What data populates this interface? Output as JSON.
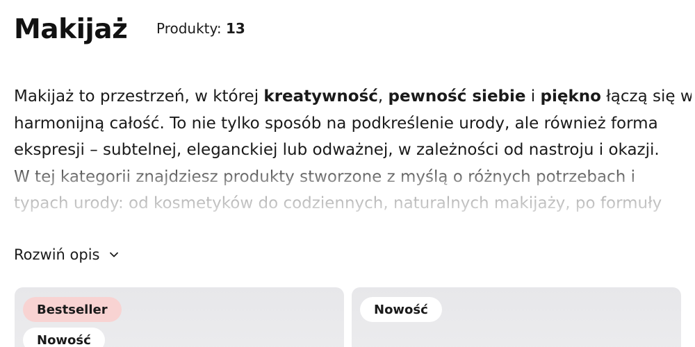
{
  "header": {
    "title": "Makijaż",
    "products_label": "Produkty:",
    "products_count": "13"
  },
  "description": {
    "lines": [
      [
        {
          "text": "Makijaż to przestrzeń, w której ",
          "bold": false
        },
        {
          "text": "kreatywność",
          "bold": true
        },
        {
          "text": ", ",
          "bold": false
        },
        {
          "text": "pewność siebie",
          "bold": true
        },
        {
          "text": " i ",
          "bold": false
        },
        {
          "text": "piękno",
          "bold": true
        },
        {
          "text": " łączą się w",
          "bold": false
        }
      ],
      [
        {
          "text": "harmonijną całość. To nie tylko sposób na podkreślenie urody, ale również forma",
          "bold": false
        }
      ],
      [
        {
          "text": "ekspresji – subtelnej, eleganckiej lub odważnej, w zależności od nastroju i okazji.",
          "bold": false
        }
      ],
      [
        {
          "text": "W tej kategorii znajdziesz produkty stworzone z myślą o różnych potrzebach i",
          "bold": false
        }
      ],
      [
        {
          "text": "typach urody: od kosmetyków do codziennych, naturalnych makijaży, po formuły",
          "bold": false
        }
      ]
    ]
  },
  "expand": {
    "label": "Rozwiń opis",
    "icon": "chevron-down-icon"
  },
  "products": [
    {
      "badges": [
        {
          "label": "Bestseller",
          "color": "#f8d3d2"
        },
        {
          "label": "Nowość",
          "color": "#ffffff"
        }
      ]
    },
    {
      "badges": [
        {
          "label": "Nowość",
          "color": "#ffffff"
        }
      ]
    }
  ]
}
